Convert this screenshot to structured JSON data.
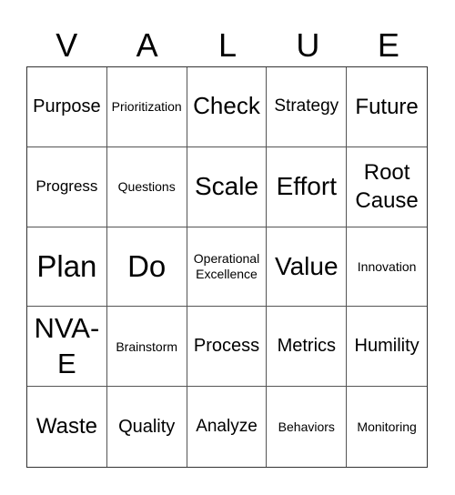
{
  "card": {
    "header": [
      "V",
      "A",
      "L",
      "U",
      "E"
    ],
    "cells": [
      "Purpose",
      "Prioritization",
      "Check",
      "Strategy",
      "Future",
      "Progress",
      "Questions",
      "Scale",
      "Effort",
      "Root Cause",
      "Plan",
      "Do",
      "Operational Excellence",
      "Value",
      "Innovation",
      "NVA-E",
      "Brainstorm",
      "Process",
      "Metrics",
      "Humility",
      "Waste",
      "Quality",
      "Analyze",
      "Behaviors",
      "Monitoring"
    ]
  }
}
